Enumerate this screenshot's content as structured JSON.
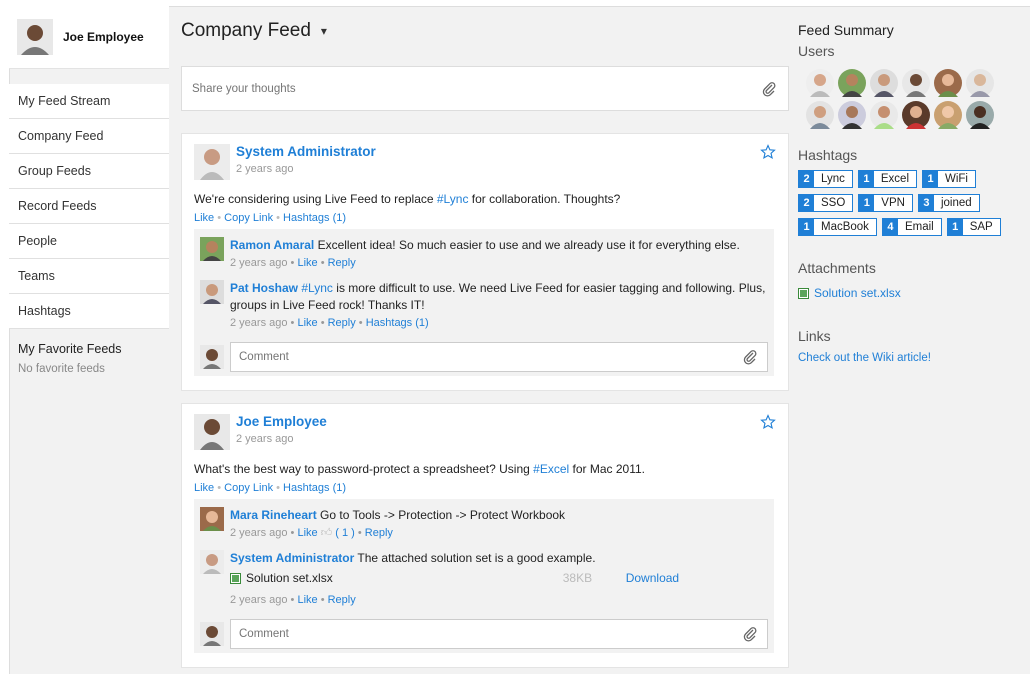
{
  "user": {
    "name": "Joe Employee"
  },
  "sidebar": {
    "items": [
      {
        "label": "My Feed Stream"
      },
      {
        "label": "Company Feed"
      },
      {
        "label": "Group Feeds"
      },
      {
        "label": "Record Feeds"
      },
      {
        "label": "People"
      },
      {
        "label": "Teams"
      },
      {
        "label": "Hashtags"
      }
    ],
    "favorites_title": "My Favorite Feeds",
    "favorites_empty": "No favorite feeds"
  },
  "main": {
    "title": "Company Feed",
    "share_placeholder": "Share your thoughts",
    "comment_placeholder": "Comment",
    "posts": [
      {
        "author": "System Administrator",
        "time": "2 years ago",
        "text_before": "We're considering using Live Feed to replace ",
        "hashtag": "#Lync",
        "text_after": " for collaboration. Thoughts?",
        "actions": {
          "like": "Like",
          "copy": "Copy Link",
          "hashtags": "Hashtags (1)"
        },
        "comments": [
          {
            "author": "Ramon Amaral",
            "text": " Excellent idea! So much easier to use and we already use it for everything else.",
            "time": "2 years ago",
            "like": "Like",
            "reply": "Reply"
          },
          {
            "author": "Pat Hoshaw",
            "hashtag": "#Lync",
            "text": " is more difficult to use. We need Live Feed for easier tagging and following. Plus, groups in Live Feed rock! Thanks IT!",
            "time": "2 years ago",
            "like": "Like",
            "reply": "Reply",
            "hashtags": "Hashtags (1)"
          }
        ]
      },
      {
        "author": "Joe Employee",
        "time": "2 years ago",
        "text_before": "What's the best way to password-protect a spreadsheet? Using ",
        "hashtag": "#Excel",
        "text_after": " for Mac 2011.",
        "actions": {
          "like": "Like",
          "copy": "Copy Link",
          "hashtags": "Hashtags (1)"
        },
        "comments": [
          {
            "author": "Mara Rineheart",
            "text": " Go to Tools -> Protection -> Protect Workbook",
            "time": "2 years ago",
            "like": "Like",
            "like_count": "( 1 )",
            "reply": "Reply"
          },
          {
            "author": "System Administrator",
            "text": " The attached solution set is a good example.",
            "file": {
              "name": "Solution set.xlsx",
              "size": "38KB",
              "download": "Download"
            },
            "time": "2 years ago",
            "like": "Like",
            "reply": "Reply"
          }
        ]
      }
    ]
  },
  "summary": {
    "title": "Feed Summary",
    "users_label": "Users",
    "hashtags_label": "Hashtags",
    "hashtags": [
      {
        "count": "2",
        "label": "Lync"
      },
      {
        "count": "1",
        "label": "Excel"
      },
      {
        "count": "1",
        "label": "WiFi"
      },
      {
        "count": "2",
        "label": "SSO"
      },
      {
        "count": "1",
        "label": "VPN"
      },
      {
        "count": "3",
        "label": "joined"
      },
      {
        "count": "1",
        "label": "MacBook"
      },
      {
        "count": "4",
        "label": "Email"
      },
      {
        "count": "1",
        "label": "SAP"
      }
    ],
    "attachments_label": "Attachments",
    "attachment": "Solution set.xlsx",
    "links_label": "Links",
    "link": "Check out the Wiki article!"
  },
  "colors": {
    "accent": "#1f7fd6",
    "background": "#f2f2f2"
  }
}
